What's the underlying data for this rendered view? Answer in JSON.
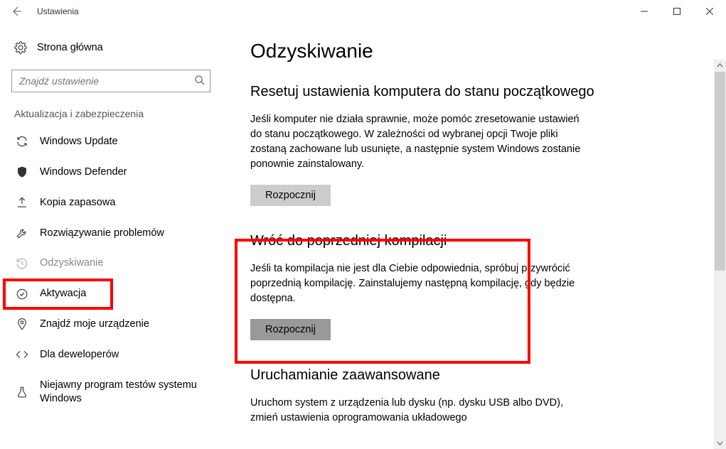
{
  "window": {
    "title": "Ustawienia"
  },
  "sidebar": {
    "home": "Strona główna",
    "search_placeholder": "Znajdź ustawienie",
    "group_header": "Aktualizacja i zabezpieczenia",
    "items": [
      {
        "label": "Windows Update"
      },
      {
        "label": "Windows Defender"
      },
      {
        "label": "Kopia zapasowa"
      },
      {
        "label": "Rozwiązywanie problemów"
      },
      {
        "label": "Odzyskiwanie"
      },
      {
        "label": "Aktywacja"
      },
      {
        "label": "Znajdź moje urządzenie"
      },
      {
        "label": "Dla deweloperów"
      },
      {
        "label": "Niejawny program testów systemu Windows"
      }
    ]
  },
  "main": {
    "page_title": "Odzyskiwanie",
    "sections": [
      {
        "title": "Resetuj ustawienia komputera do stanu początkowego",
        "desc": "Jeśli komputer nie działa sprawnie, może pomóc zresetowanie ustawień do stanu początkowego. W zależności od wybranej opcji Twoje pliki zostaną zachowane lub usunięte, a następnie system Windows zostanie ponownie zainstalowany.",
        "button": "Rozpocznij"
      },
      {
        "title": "Wróć do poprzedniej kompilacji",
        "desc": "Jeśli ta kompilacja nie jest dla Ciebie odpowiednia, spróbuj przywrócić poprzednią kompilację. Zainstalujemy następną kompilację, gdy będzie dostępna.",
        "button": "Rozpocznij"
      },
      {
        "title": "Uruchamianie zaawansowane",
        "desc": "Uruchom system z urządzenia lub dysku (np. dysku USB albo DVD), zmień ustawienia oprogramowania układowego"
      }
    ]
  }
}
